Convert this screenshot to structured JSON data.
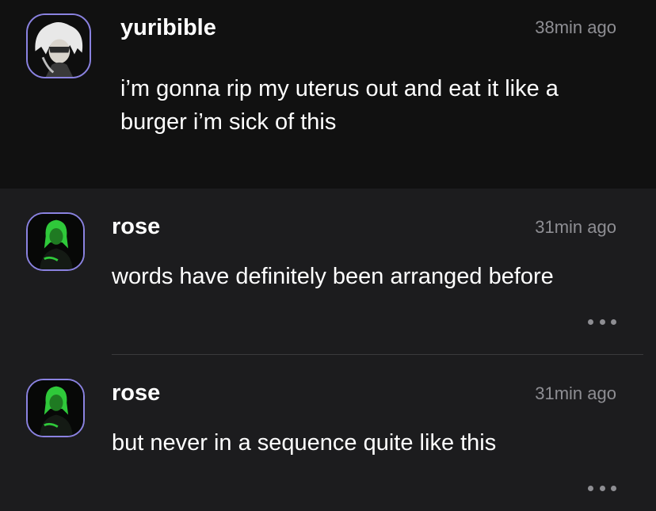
{
  "posts": [
    {
      "username": "yuribible",
      "time": "38min ago",
      "text": "i’m gonna rip my uterus out and eat it like a burger i’m sick of this",
      "avatar_icon": "white-haired-character-avatar"
    }
  ],
  "replies": [
    {
      "username": "rose",
      "time": "31min ago",
      "text": "words have definitely been arranged before",
      "avatar_icon": "green-haired-person-avatar"
    },
    {
      "username": "rose",
      "time": "31min ago",
      "text": "but never in a sequence quite like this",
      "avatar_icon": "green-haired-person-avatar"
    }
  ],
  "colors": {
    "top_background": "#111111",
    "reply_background": "#1c1c1e",
    "avatar_border": "#8a82e0",
    "muted_text": "#8e8e93"
  }
}
